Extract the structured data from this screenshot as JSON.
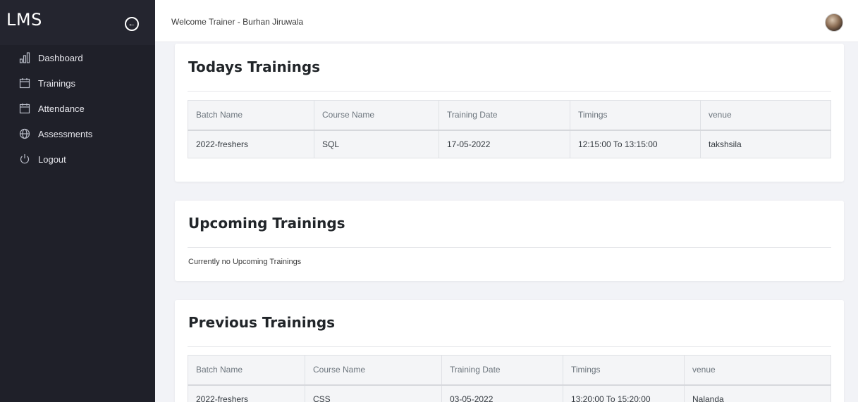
{
  "sidebar": {
    "brand": "LMS",
    "collapse_icon": "arrow-left-circle-icon",
    "items": [
      {
        "label": "Dashboard",
        "icon": "bar-chart-icon"
      },
      {
        "label": "Trainings",
        "icon": "calendar-icon"
      },
      {
        "label": "Attendance",
        "icon": "calendar-icon"
      },
      {
        "label": "Assessments",
        "icon": "globe-icon"
      },
      {
        "label": "Logout",
        "icon": "power-icon"
      }
    ]
  },
  "topbar": {
    "welcome": "Welcome Trainer - Burhan Jiruwala"
  },
  "todays": {
    "title": "Todays Trainings",
    "headers": [
      "Batch Name",
      "Course Name",
      "Training Date",
      "Timings",
      "venue"
    ],
    "rows": [
      [
        "2022-freshers",
        "SQL",
        "17-05-2022",
        "12:15:00 To 13:15:00",
        "takshsila"
      ]
    ]
  },
  "upcoming": {
    "title": "Upcoming Trainings",
    "empty_text": "Currently no Upcoming Trainings"
  },
  "previous": {
    "title": "Previous Trainings",
    "headers": [
      "Batch Name",
      "Course Name",
      "Training Date",
      "Timings",
      "venue"
    ],
    "rows": [
      [
        "2022-freshers",
        "CSS",
        "03-05-2022",
        "13:20:00 To 15:20:00",
        "Nalanda"
      ]
    ]
  }
}
